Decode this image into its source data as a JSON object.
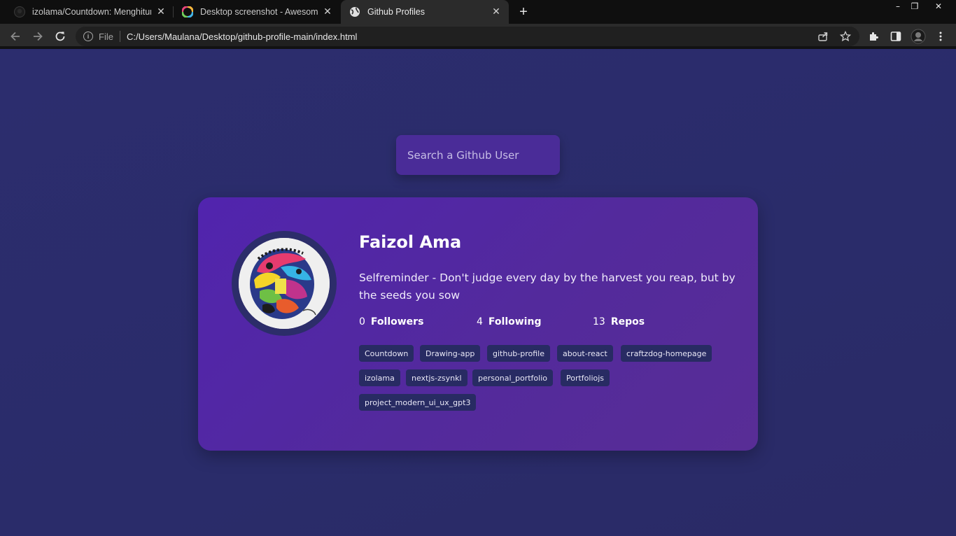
{
  "browser": {
    "tabs": [
      {
        "title": "izolama/Countdown: Menghitun",
        "icon": "github-icon"
      },
      {
        "title": "Desktop screenshot - Awesome S",
        "icon": "awesome-screenshot-icon"
      },
      {
        "title": "Github Profiles",
        "icon": "globe-icon"
      }
    ],
    "new_tab_label": "+",
    "close_label": "✕",
    "window_controls": {
      "minimize": "–",
      "restore": "❐",
      "close": "✕"
    },
    "address": {
      "scheme_label": "File",
      "url": "C:/Users/Maulana/Desktop/github-profile-main/index.html"
    }
  },
  "search": {
    "placeholder": "Search a Github User"
  },
  "profile": {
    "name": "Faizol Ama",
    "bio": "Selfreminder - Don't judge every day by the harvest you reap, but by the seeds you sow",
    "stats": [
      {
        "value": "0",
        "label": "Followers"
      },
      {
        "value": "4",
        "label": "Following"
      },
      {
        "value": "13",
        "label": "Repos"
      }
    ],
    "repos": [
      "Countdown",
      "Drawing-app",
      "github-profile",
      "about-react",
      "craftzdog-homepage",
      "izolama",
      "nextjs-zsynkl",
      "personal_portfolio",
      "Portfoliojs",
      "project_modern_ui_ux_gpt3"
    ]
  },
  "colors": {
    "page_bg": "#2a2b6a",
    "card_bg": "#5124ae",
    "search_bg": "#4a2c98",
    "repo_bg": "#282b63"
  }
}
